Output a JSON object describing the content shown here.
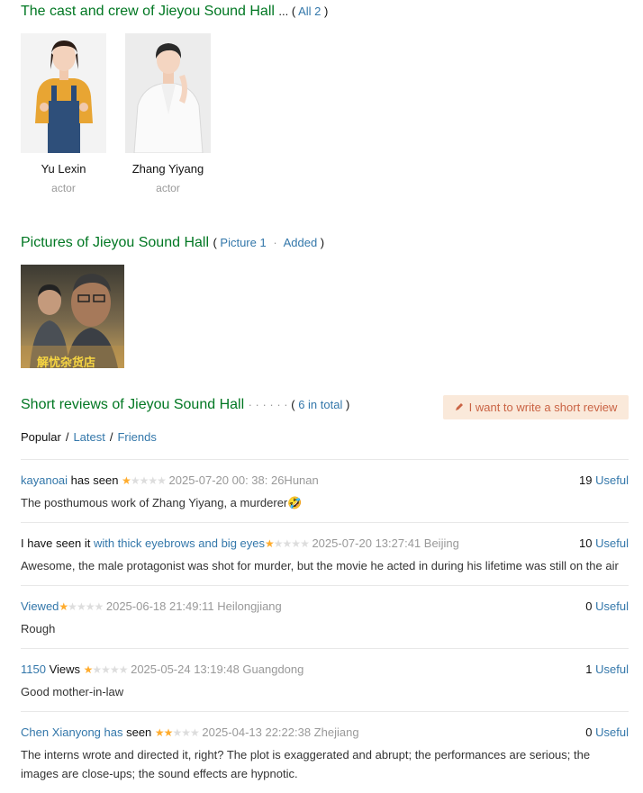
{
  "cast_section": {
    "title": "The cast and crew of Jieyou Sound Hall",
    "ellipsis": "...",
    "all_link": "All 2",
    "members": [
      {
        "name": "Yu Lexin",
        "role": "actor"
      },
      {
        "name": "Zhang Yiyang",
        "role": "actor"
      }
    ]
  },
  "pictures_section": {
    "title": "Pictures of Jieyou Sound Hall",
    "picture_link": "Picture 1",
    "added_link": "Added",
    "poster_text": "解忧杂货店"
  },
  "reviews_section": {
    "title": "Short reviews of Jieyou Sound Hall",
    "dots": "· · · · · ·",
    "total_link": "6 in total",
    "write_button": "I want to write a short review",
    "tabs": [
      "Popular",
      "Latest",
      "Friends"
    ],
    "comments": [
      {
        "pre": "",
        "user": "kayanoai",
        "verb": " has seen ",
        "rating": 1,
        "meta": "2025-07-20 00: 38: 26Hunan",
        "useful_count": "19",
        "useful_label": "Useful",
        "text": "The posthumous work of Zhang Yiyang, a murderer🤣"
      },
      {
        "pre": "I have seen it ",
        "user": "with thick eyebrows and big eyes",
        "verb": "",
        "rating": 1,
        "meta": "2025-07-20 13:27:41 Beijing",
        "useful_count": "10",
        "useful_label": "Useful",
        "text": "Awesome, the male protagonist was shot for murder, but the movie he acted in during his lifetime was still on the air"
      },
      {
        "pre": "",
        "user": "Viewed",
        "verb": "",
        "rating": 1,
        "meta": "2025-06-18 21:49:11 Heilongjiang",
        "useful_count": "0",
        "useful_label": "Useful",
        "text": "Rough"
      },
      {
        "pre": "",
        "user": "1150",
        "verb": " Views ",
        "rating": 1,
        "meta": "2025-05-24 13:19:48 Guangdong",
        "useful_count": "1",
        "useful_label": "Useful",
        "text": "Good mother-in-law"
      },
      {
        "pre": "",
        "user": "Chen Xianyong has",
        "verb": " seen ",
        "rating": 2,
        "meta": "2025-04-13 22:22:38 Zhejiang",
        "useful_count": "0",
        "useful_label": "Useful",
        "text": "The interns wrote and directed it, right? The plot is exaggerated and abrupt; the performances are serious; the images are close-ups; the sound effects are hypnotic."
      }
    ]
  },
  "colors": {
    "heading_green": "#007722",
    "link_blue": "#3377aa",
    "star_on": "#ffac2d",
    "star_off": "#dddddd",
    "write_button_bg": "#fae9da",
    "write_button_text": "#ca6445"
  }
}
